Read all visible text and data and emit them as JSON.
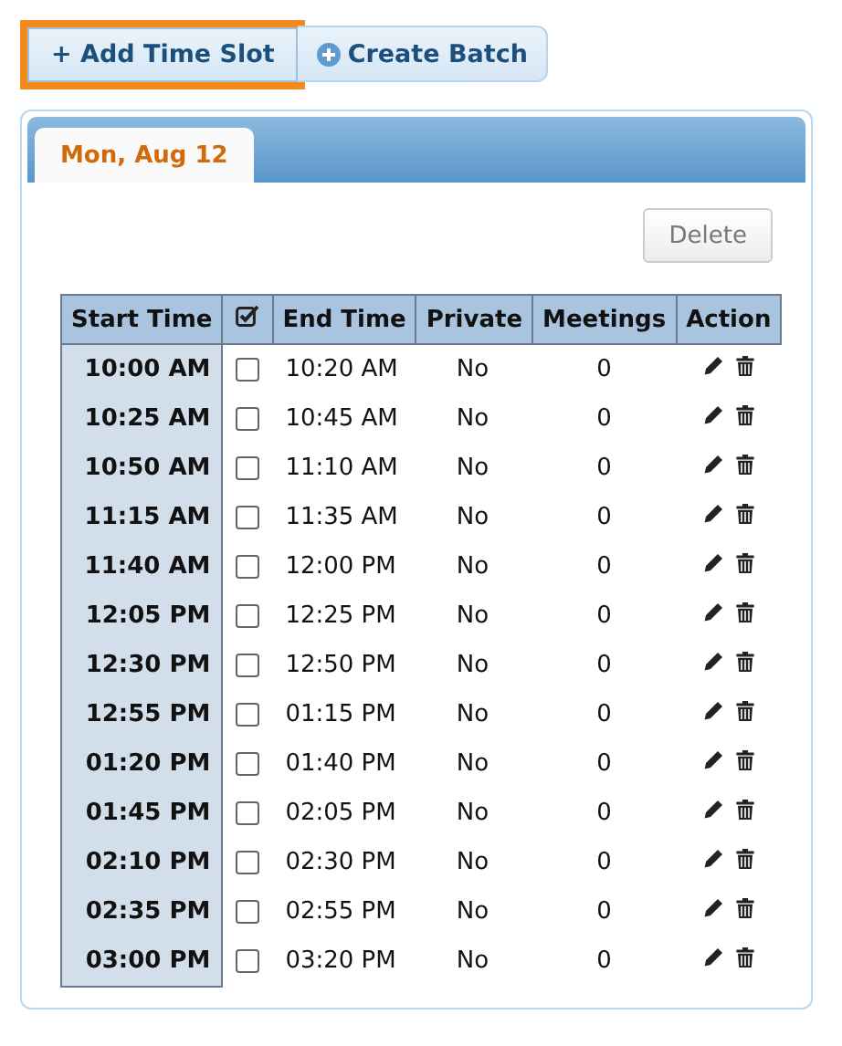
{
  "toolbar": [
    {
      "kind": "plus",
      "label": "+ Add Time Slot",
      "focused": true
    },
    {
      "kind": "circle-plus",
      "label": "Create Batch",
      "focused": false
    }
  ],
  "tabs": [
    {
      "label": "Mon, Aug 12",
      "selected": true
    }
  ],
  "delete_button": {
    "label": "Delete"
  },
  "table": {
    "columns": [
      "Start Time",
      "End Time",
      "Private",
      "Meetings",
      "Action"
    ],
    "rows": [
      {
        "start": "10:00 AM",
        "checked": false,
        "end": "10:20 AM",
        "private": "No",
        "meetings": "0"
      },
      {
        "start": "10:25 AM",
        "checked": false,
        "end": "10:45 AM",
        "private": "No",
        "meetings": "0"
      },
      {
        "start": "10:50 AM",
        "checked": false,
        "end": "11:10 AM",
        "private": "No",
        "meetings": "0"
      },
      {
        "start": "11:15 AM",
        "checked": false,
        "end": "11:35 AM",
        "private": "No",
        "meetings": "0"
      },
      {
        "start": "11:40 AM",
        "checked": false,
        "end": "12:00 PM",
        "private": "No",
        "meetings": "0"
      },
      {
        "start": "12:05 PM",
        "checked": false,
        "end": "12:25 PM",
        "private": "No",
        "meetings": "0"
      },
      {
        "start": "12:30 PM",
        "checked": false,
        "end": "12:50 PM",
        "private": "No",
        "meetings": "0"
      },
      {
        "start": "12:55 PM",
        "checked": false,
        "end": "01:15 PM",
        "private": "No",
        "meetings": "0"
      },
      {
        "start": "01:20 PM",
        "checked": false,
        "end": "01:40 PM",
        "private": "No",
        "meetings": "0"
      },
      {
        "start": "01:45 PM",
        "checked": false,
        "end": "02:05 PM",
        "private": "No",
        "meetings": "0"
      },
      {
        "start": "02:10 PM",
        "checked": false,
        "end": "02:30 PM",
        "private": "No",
        "meetings": "0"
      },
      {
        "start": "02:35 PM",
        "checked": false,
        "end": "02:55 PM",
        "private": "No",
        "meetings": "0"
      },
      {
        "start": "03:00 PM",
        "checked": false,
        "end": "03:20 PM",
        "private": "No",
        "meetings": "0"
      }
    ]
  }
}
